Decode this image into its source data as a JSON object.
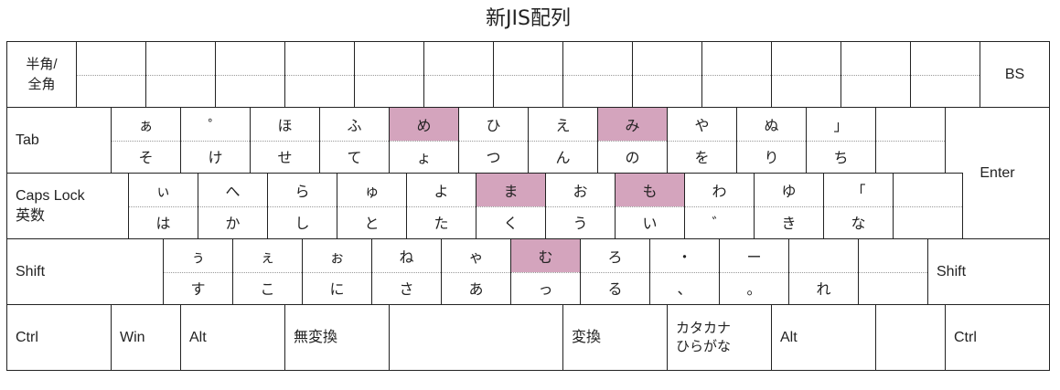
{
  "title": "新JIS配列",
  "colors": {
    "highlight": "#d4a4bd",
    "border": "#222222",
    "divider": "#999999"
  },
  "rows": [
    {
      "keys": [
        {
          "name": "key-hankaku-zenkaku",
          "label": "半角/\n全角",
          "align": "center"
        },
        {
          "name": "key-num-1",
          "top": "",
          "bottom": ""
        },
        {
          "name": "key-num-2",
          "top": "",
          "bottom": ""
        },
        {
          "name": "key-num-3",
          "top": "",
          "bottom": ""
        },
        {
          "name": "key-num-4",
          "top": "",
          "bottom": ""
        },
        {
          "name": "key-num-5",
          "top": "",
          "bottom": ""
        },
        {
          "name": "key-num-6",
          "top": "",
          "bottom": ""
        },
        {
          "name": "key-num-7",
          "top": "",
          "bottom": ""
        },
        {
          "name": "key-num-8",
          "top": "",
          "bottom": ""
        },
        {
          "name": "key-num-9",
          "top": "",
          "bottom": ""
        },
        {
          "name": "key-num-0",
          "top": "",
          "bottom": ""
        },
        {
          "name": "key-num-minus",
          "top": "",
          "bottom": ""
        },
        {
          "name": "key-num-caret",
          "top": "",
          "bottom": ""
        },
        {
          "name": "key-num-yen",
          "top": "",
          "bottom": ""
        },
        {
          "name": "key-bs",
          "label": "BS",
          "align": "center"
        }
      ]
    },
    {
      "keys": [
        {
          "name": "key-tab",
          "label": "Tab"
        },
        {
          "name": "key-q",
          "top": "ぁ",
          "bottom": "そ"
        },
        {
          "name": "key-w",
          "top": "゜",
          "bottom": "け"
        },
        {
          "name": "key-e",
          "top": "ほ",
          "bottom": "せ"
        },
        {
          "name": "key-r",
          "top": "ふ",
          "bottom": "て"
        },
        {
          "name": "key-t",
          "top": "め",
          "bottom": "ょ",
          "hl_top": true
        },
        {
          "name": "key-y",
          "top": "ひ",
          "bottom": "つ"
        },
        {
          "name": "key-u",
          "top": "え",
          "bottom": "ん"
        },
        {
          "name": "key-i",
          "top": "み",
          "bottom": "の",
          "hl_top": true
        },
        {
          "name": "key-o",
          "top": "や",
          "bottom": "を"
        },
        {
          "name": "key-p",
          "top": "ぬ",
          "bottom": "り"
        },
        {
          "name": "key-at",
          "top": "」",
          "bottom": "ち"
        },
        {
          "name": "key-bracket-open",
          "top": "",
          "bottom": ""
        },
        {
          "name": "key-enter",
          "label": "Enter",
          "align": "center"
        }
      ]
    },
    {
      "keys": [
        {
          "name": "key-caps-lock",
          "label": "Caps Lock\n英数"
        },
        {
          "name": "key-a",
          "top": "ぃ",
          "bottom": "は"
        },
        {
          "name": "key-s",
          "top": "へ",
          "bottom": "か"
        },
        {
          "name": "key-d",
          "top": "ら",
          "bottom": "し"
        },
        {
          "name": "key-f",
          "top": "ゅ",
          "bottom": "と"
        },
        {
          "name": "key-g",
          "top": "よ",
          "bottom": "た"
        },
        {
          "name": "key-h",
          "top": "ま",
          "bottom": "く",
          "hl_top": true
        },
        {
          "name": "key-j",
          "top": "お",
          "bottom": "う"
        },
        {
          "name": "key-k",
          "top": "も",
          "bottom": "い",
          "hl_top": true
        },
        {
          "name": "key-l",
          "top": "わ",
          "bottom": "゛"
        },
        {
          "name": "key-semicolon",
          "top": "ゆ",
          "bottom": "き"
        },
        {
          "name": "key-colon",
          "top": "「",
          "bottom": "な"
        },
        {
          "name": "key-bracket-close",
          "top": "",
          "bottom": ""
        }
      ]
    },
    {
      "keys": [
        {
          "name": "key-shift-left",
          "label": "Shift"
        },
        {
          "name": "key-z",
          "top": "ぅ",
          "bottom": "す"
        },
        {
          "name": "key-x",
          "top": "ぇ",
          "bottom": "こ"
        },
        {
          "name": "key-c",
          "top": "ぉ",
          "bottom": "に"
        },
        {
          "name": "key-v",
          "top": "ね",
          "bottom": "さ"
        },
        {
          "name": "key-b",
          "top": "ゃ",
          "bottom": "あ"
        },
        {
          "name": "key-n",
          "top": "む",
          "bottom": "っ",
          "hl_top": true
        },
        {
          "name": "key-m",
          "top": "ろ",
          "bottom": "る"
        },
        {
          "name": "key-comma",
          "top": "・",
          "bottom": "、"
        },
        {
          "name": "key-period",
          "top": "ー",
          "bottom": "。"
        },
        {
          "name": "key-slash",
          "top": "",
          "bottom": "れ"
        },
        {
          "name": "key-backslash",
          "top": "",
          "bottom": ""
        },
        {
          "name": "key-shift-right",
          "label": "Shift"
        }
      ]
    },
    {
      "keys": [
        {
          "name": "key-ctrl-left",
          "label": "Ctrl"
        },
        {
          "name": "key-win",
          "label": "Win"
        },
        {
          "name": "key-alt-left",
          "label": "Alt"
        },
        {
          "name": "key-muhenkan",
          "label": "無変換"
        },
        {
          "name": "key-space",
          "label": ""
        },
        {
          "name": "key-henkan",
          "label": "変換"
        },
        {
          "name": "key-katakana-hiragana",
          "label": "カタカナ\nひらがな",
          "small": true
        },
        {
          "name": "key-alt-right",
          "label": "Alt"
        },
        {
          "name": "key-blank",
          "label": ""
        },
        {
          "name": "key-ctrl-right",
          "label": "Ctrl"
        }
      ]
    }
  ]
}
